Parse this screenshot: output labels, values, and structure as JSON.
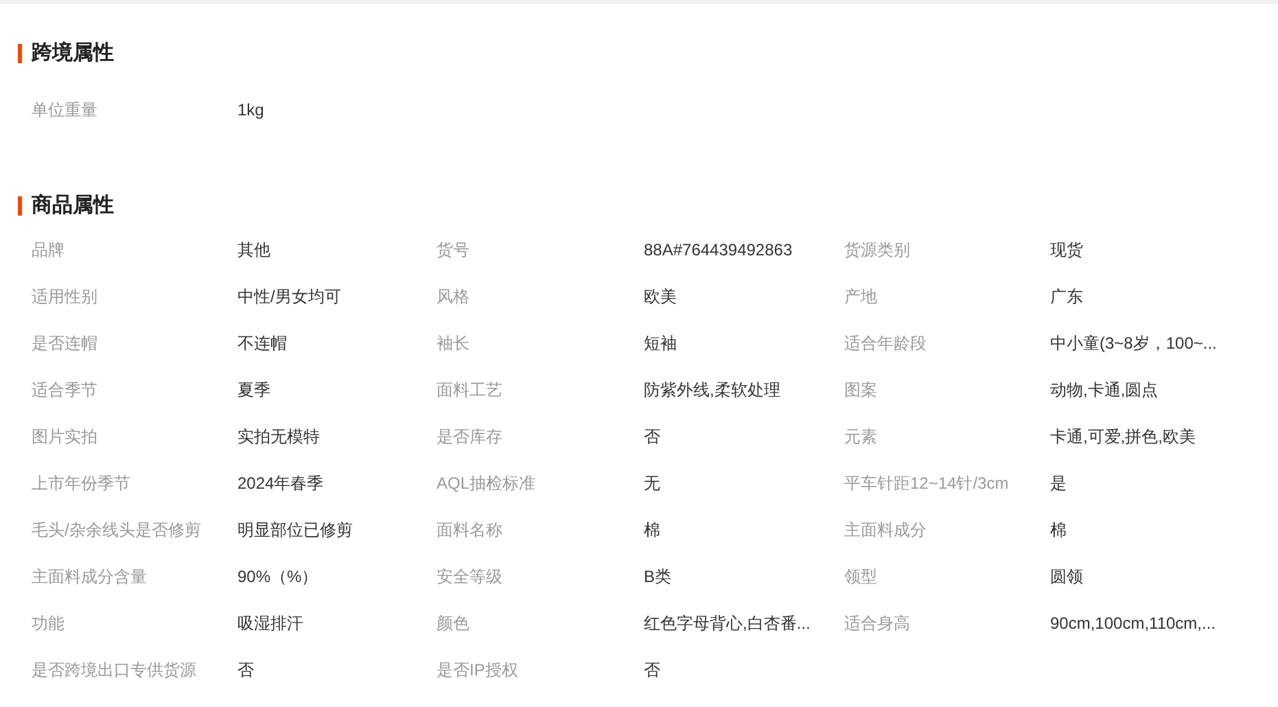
{
  "sections": [
    {
      "title": "跨境属性",
      "attributes": [
        {
          "label": "单位重量",
          "value": "1kg"
        }
      ]
    },
    {
      "title": "商品属性",
      "attributes": [
        {
          "label": "品牌",
          "value": "其他"
        },
        {
          "label": "货号",
          "value": "88A#764439492863"
        },
        {
          "label": "货源类别",
          "value": "现货"
        },
        {
          "label": "适用性别",
          "value": "中性/男女均可"
        },
        {
          "label": "风格",
          "value": "欧美"
        },
        {
          "label": "产地",
          "value": "广东"
        },
        {
          "label": "是否连帽",
          "value": "不连帽"
        },
        {
          "label": "袖长",
          "value": "短袖"
        },
        {
          "label": "适合年龄段",
          "value": "中小童(3~8岁，100~..."
        },
        {
          "label": "适合季节",
          "value": "夏季"
        },
        {
          "label": "面料工艺",
          "value": "防紫外线,柔软处理"
        },
        {
          "label": "图案",
          "value": "动物,卡通,圆点"
        },
        {
          "label": "图片实拍",
          "value": "实拍无模特"
        },
        {
          "label": "是否库存",
          "value": "否"
        },
        {
          "label": "元素",
          "value": "卡通,可爱,拼色,欧美"
        },
        {
          "label": "上市年份季节",
          "value": "2024年春季"
        },
        {
          "label": "AQL抽检标准",
          "value": "无"
        },
        {
          "label": "平车针距12~14针/3cm",
          "value": "是"
        },
        {
          "label": "毛头/杂余线头是否修剪",
          "value": "明显部位已修剪"
        },
        {
          "label": "面料名称",
          "value": "棉"
        },
        {
          "label": "主面料成分",
          "value": "棉"
        },
        {
          "label": "主面料成分含量",
          "value": "90%（%）"
        },
        {
          "label": "安全等级",
          "value": "B类"
        },
        {
          "label": "领型",
          "value": "圆领"
        },
        {
          "label": "功能",
          "value": "吸湿排汗"
        },
        {
          "label": "颜色",
          "value": "红色字母背心,白杏番..."
        },
        {
          "label": "适合身高",
          "value": "90cm,100cm,110cm,..."
        },
        {
          "label": "是否跨境出口专供货源",
          "value": "否"
        },
        {
          "label": "是否IP授权",
          "value": "否"
        }
      ]
    }
  ]
}
